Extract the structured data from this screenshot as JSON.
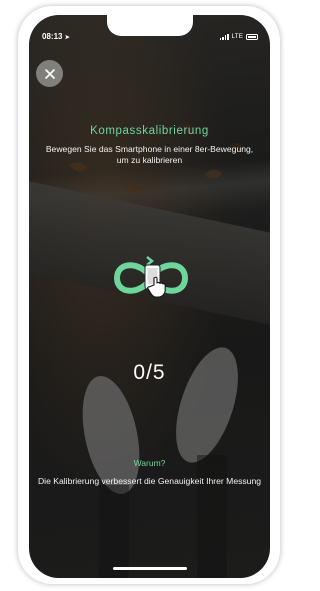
{
  "status_bar": {
    "time": "08:13",
    "network": "LTE"
  },
  "screen": {
    "title": "Kompasskalibrierung",
    "instruction": "Bewegen Sie das Smartphone in einer 8er-Bewegung, um zu kalibrieren",
    "progress": "0/5",
    "progress_value": {
      "done": 0,
      "total": 5
    },
    "why_title": "Warum?",
    "why_text": "Die Kalibrierung verbessert die Genauigkeit Ihrer Messung"
  },
  "icons": {
    "close": "close-icon",
    "gesture": "figure-eight-phone-icon"
  },
  "colors": {
    "accent": "#6fd69b",
    "text": "#f2f2f2",
    "close_button_bg": "#c8c8c8"
  }
}
